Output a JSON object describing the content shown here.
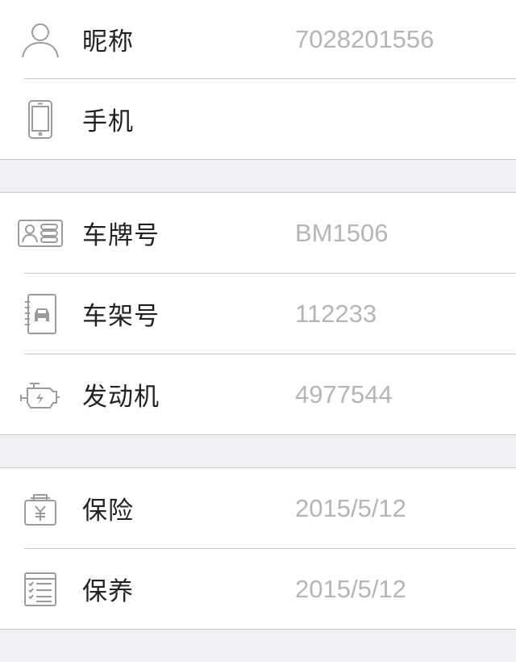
{
  "profile": {
    "nickname": {
      "label": "昵称",
      "value": "7028201556",
      "icon": "person-icon"
    },
    "phone": {
      "label": "手机",
      "value": "",
      "icon": "phone-icon"
    }
  },
  "vehicle": {
    "plate": {
      "label": "车牌号",
      "value": "BM1506",
      "icon": "id-card-icon"
    },
    "vin": {
      "label": "车架号",
      "value": "112233",
      "icon": "car-notebook-icon"
    },
    "engine": {
      "label": "发动机",
      "value": "4977544",
      "icon": "engine-icon"
    }
  },
  "service": {
    "insurance": {
      "label": "保险",
      "value": "2015/5/12",
      "icon": "yuan-bag-icon"
    },
    "maintenance": {
      "label": "保养",
      "value": "2015/5/12",
      "icon": "checklist-icon"
    }
  },
  "colors": {
    "label": "#222222",
    "value": "#b4b4b9",
    "icon": "#9b9b9b",
    "background": "#efeff4",
    "separator": "#c8c7cc"
  }
}
